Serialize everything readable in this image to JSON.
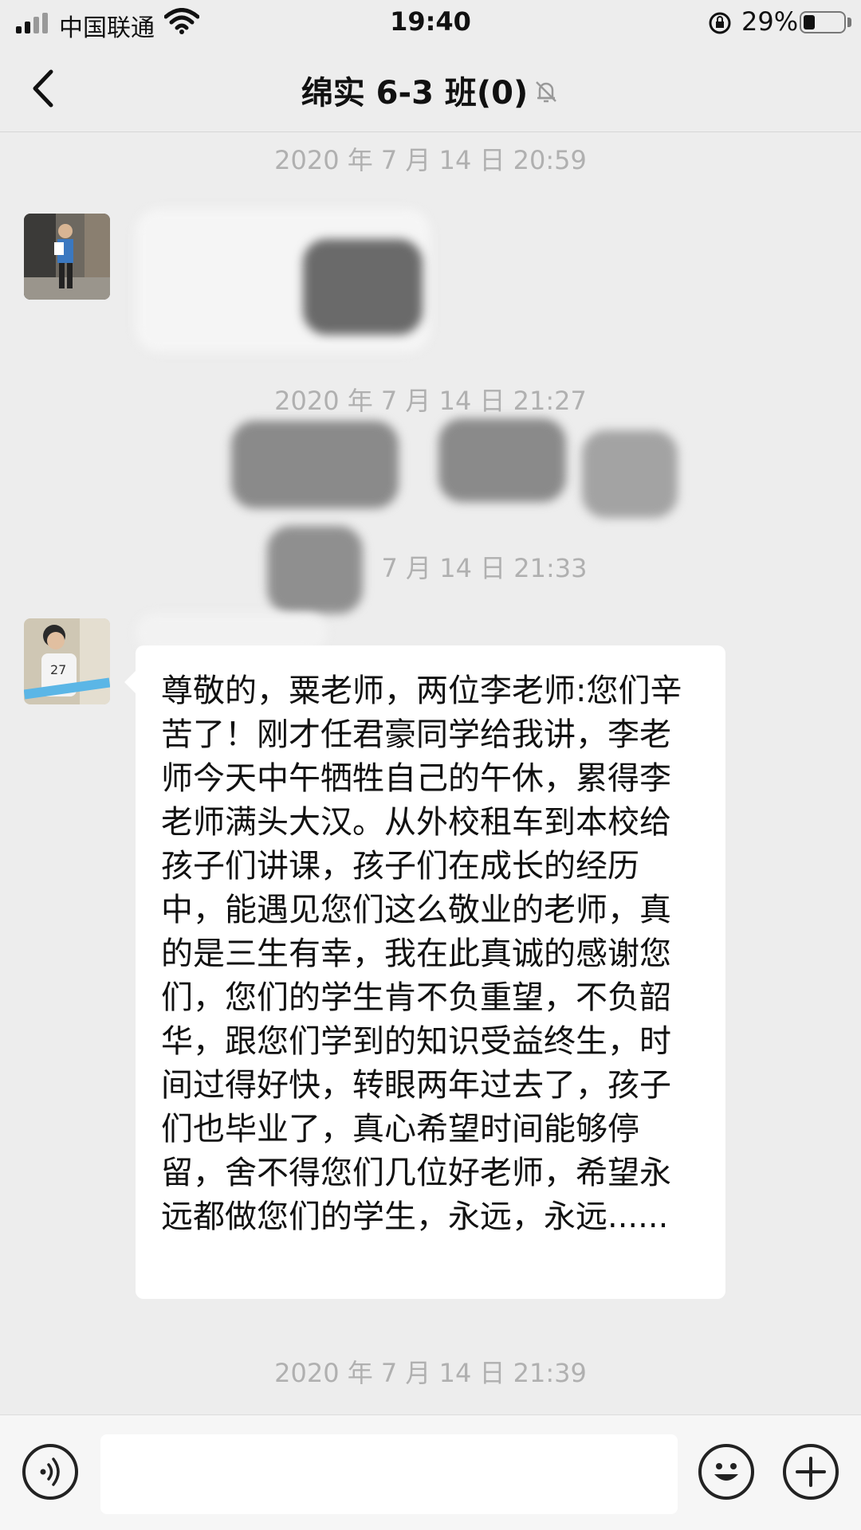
{
  "status_bar": {
    "carrier": "中国联通",
    "time": "19:40",
    "battery_percent": "29%",
    "battery_level": 0.29
  },
  "nav": {
    "title": "绵实 6-3 班(0)",
    "back_icon": "chevron-left-icon",
    "mute_icon": "bell-slash-icon"
  },
  "messages": [
    {
      "timestamp": "2020 年 7 月 14 日 20:59"
    },
    {
      "timestamp": "2020 年 7 月 14 日 21:27"
    },
    {
      "timestamp": "7 月 14 日 21:33"
    },
    {
      "text": "尊敬的，粟老师，两位李老师:您们辛苦了！刚才任君豪同学给我讲，李老师今天中午牺牲自己的午休，累得李老师满头大汉。从外校租车到本校给孩子们讲课，孩子们在成长的经历中，能遇见您们这么敬业的老师，真的是三生有幸，我在此真诚的感谢您们，您们的学生肯不负重望，不负韶华，跟您们学到的知识受益终生，时间过得好快，转眼两年过去了，孩子们也毕业了，真心希望时间能够停留，舍不得您们几位好老师，希望永远都做您们的学生，永远，永远......"
    },
    {
      "timestamp": "2020 年 7 月 14 日 21:39"
    }
  ],
  "input_bar": {
    "voice_icon": "voice-icon",
    "emoji_icon": "emoji-icon",
    "plus_icon": "plus-icon",
    "input_value": ""
  },
  "colors": {
    "background": "#ededed",
    "bubble": "#ffffff",
    "timestamp": "#b0b0b0"
  }
}
